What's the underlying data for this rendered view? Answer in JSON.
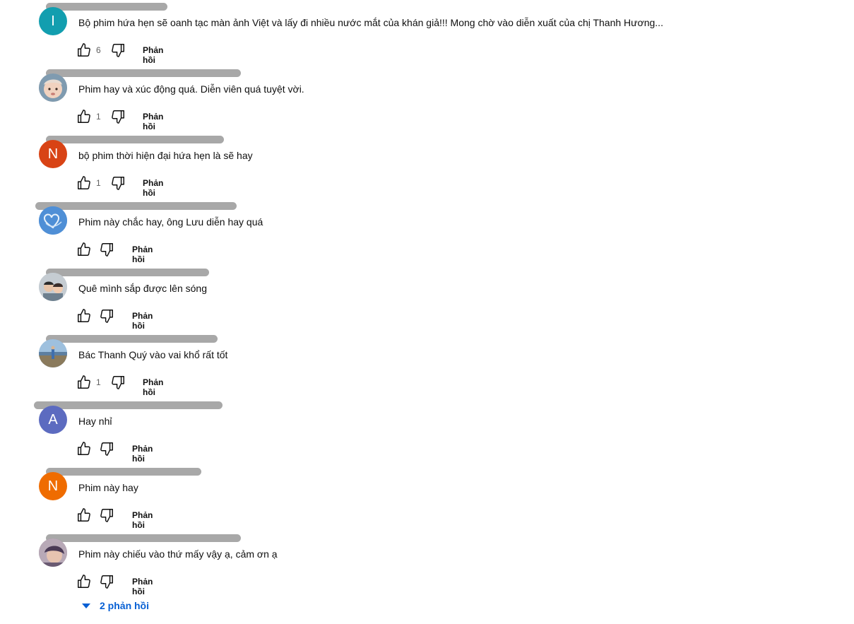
{
  "reply_label": "Phản hồi",
  "comments": [
    {
      "avatar_letter": "I",
      "avatar_color": "#129eaf",
      "text": "Bộ phim hứa hẹn sẽ oanh tạc màn ảnh Việt và lấy đi nhiều nước mắt của khán giả!!! Mong chờ vào diễn xuất của chị Thanh Hương...",
      "likes": "6"
    },
    {
      "avatar_letter": "",
      "avatar_color": "#c9b9a8",
      "text": "Phim hay và xúc động quá. Diễn viên quá tuyệt vời.",
      "likes": "1"
    },
    {
      "avatar_letter": "N",
      "avatar_color": "#d84315",
      "text": "bộ phim thời hiện đại  hứa hẹn là sẽ hay",
      "likes": "1"
    },
    {
      "avatar_letter": "",
      "avatar_color": "#4f8fd6",
      "text": "Phim này chắc hay, ông Lưu diễn hay quá",
      "likes": ""
    },
    {
      "avatar_letter": "",
      "avatar_color": "#b9c4cc",
      "text": "Quê mình sắp được lên sóng",
      "likes": ""
    },
    {
      "avatar_letter": "",
      "avatar_color": "#7aa3c8",
      "text": "Bác Thanh Quý vào vai khổ rất tốt",
      "likes": "1"
    },
    {
      "avatar_letter": "A",
      "avatar_color": "#5c6bc0",
      "text": "Hay nhỉ",
      "likes": ""
    },
    {
      "avatar_letter": "N",
      "avatar_color": "#ef6c00",
      "text": "Phim này hay",
      "likes": ""
    },
    {
      "avatar_letter": "",
      "avatar_color": "#8d7b8c",
      "text": "Phim này chiếu vào thứ mấy vậy ạ, cảm ơn ạ",
      "likes": ""
    }
  ],
  "replies_toggle": {
    "label": "2 phản hồi",
    "color": "#065fd4"
  }
}
